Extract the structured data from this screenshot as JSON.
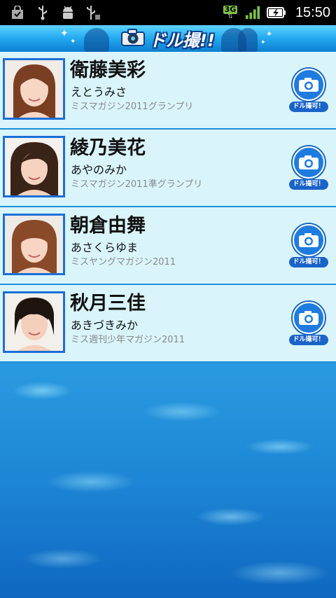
{
  "status_bar": {
    "left_icons": [
      "shopping-bag-icon",
      "usb-icon",
      "android-debug-icon",
      "usb-storage-icon"
    ],
    "network_type": "3G",
    "time": "15:50"
  },
  "app": {
    "title": "ドル撮!!",
    "brand_color": "#22a8ef"
  },
  "idols": [
    {
      "name": "衛藤美彩",
      "kana": "えとうみさ",
      "award": "ミスマガジン2011グランプリ",
      "badge_label": "ドル撮可！"
    },
    {
      "name": "綾乃美花",
      "kana": "あやのみか",
      "award": "ミスマガジン2011準グランプリ",
      "badge_label": "ドル撮可！"
    },
    {
      "name": "朝倉由舞",
      "kana": "あさくらゆま",
      "award": "ミスヤングマガジン2011",
      "badge_label": "ドル撮可！"
    },
    {
      "name": "秋月三佳",
      "kana": "あきづきみか",
      "award": "ミス週刊少年マガジン2011",
      "badge_label": "ドル撮可！"
    }
  ]
}
